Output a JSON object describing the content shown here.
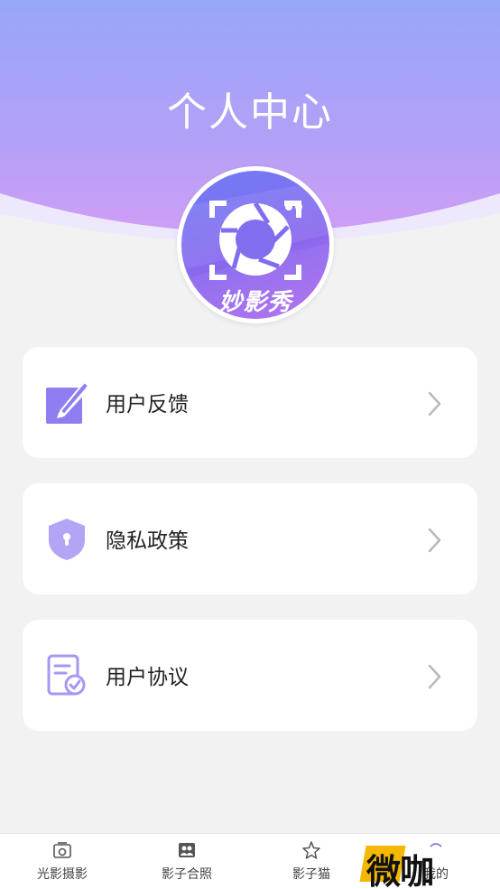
{
  "header": {
    "title": "个人中心"
  },
  "avatar": {
    "logo_text": "妙影秀"
  },
  "menu": [
    {
      "label": "用户反馈",
      "icon": "edit-icon"
    },
    {
      "label": "隐私政策",
      "icon": "shield-lock-icon"
    },
    {
      "label": "用户协议",
      "icon": "document-check-icon"
    }
  ],
  "tabbar": [
    {
      "label": "光影摄影",
      "icon": "camera-frame-icon"
    },
    {
      "label": "影子合照",
      "icon": "group-photo-icon"
    },
    {
      "label": "影子猫",
      "icon": "star-icon"
    },
    {
      "label": "我的",
      "icon": "profile-icon"
    }
  ],
  "watermark": {
    "text": "微咖"
  },
  "colors": {
    "accent": "#8d7ef2",
    "header_top": "#8fa3f8",
    "header_bottom": "#c49cf6"
  }
}
